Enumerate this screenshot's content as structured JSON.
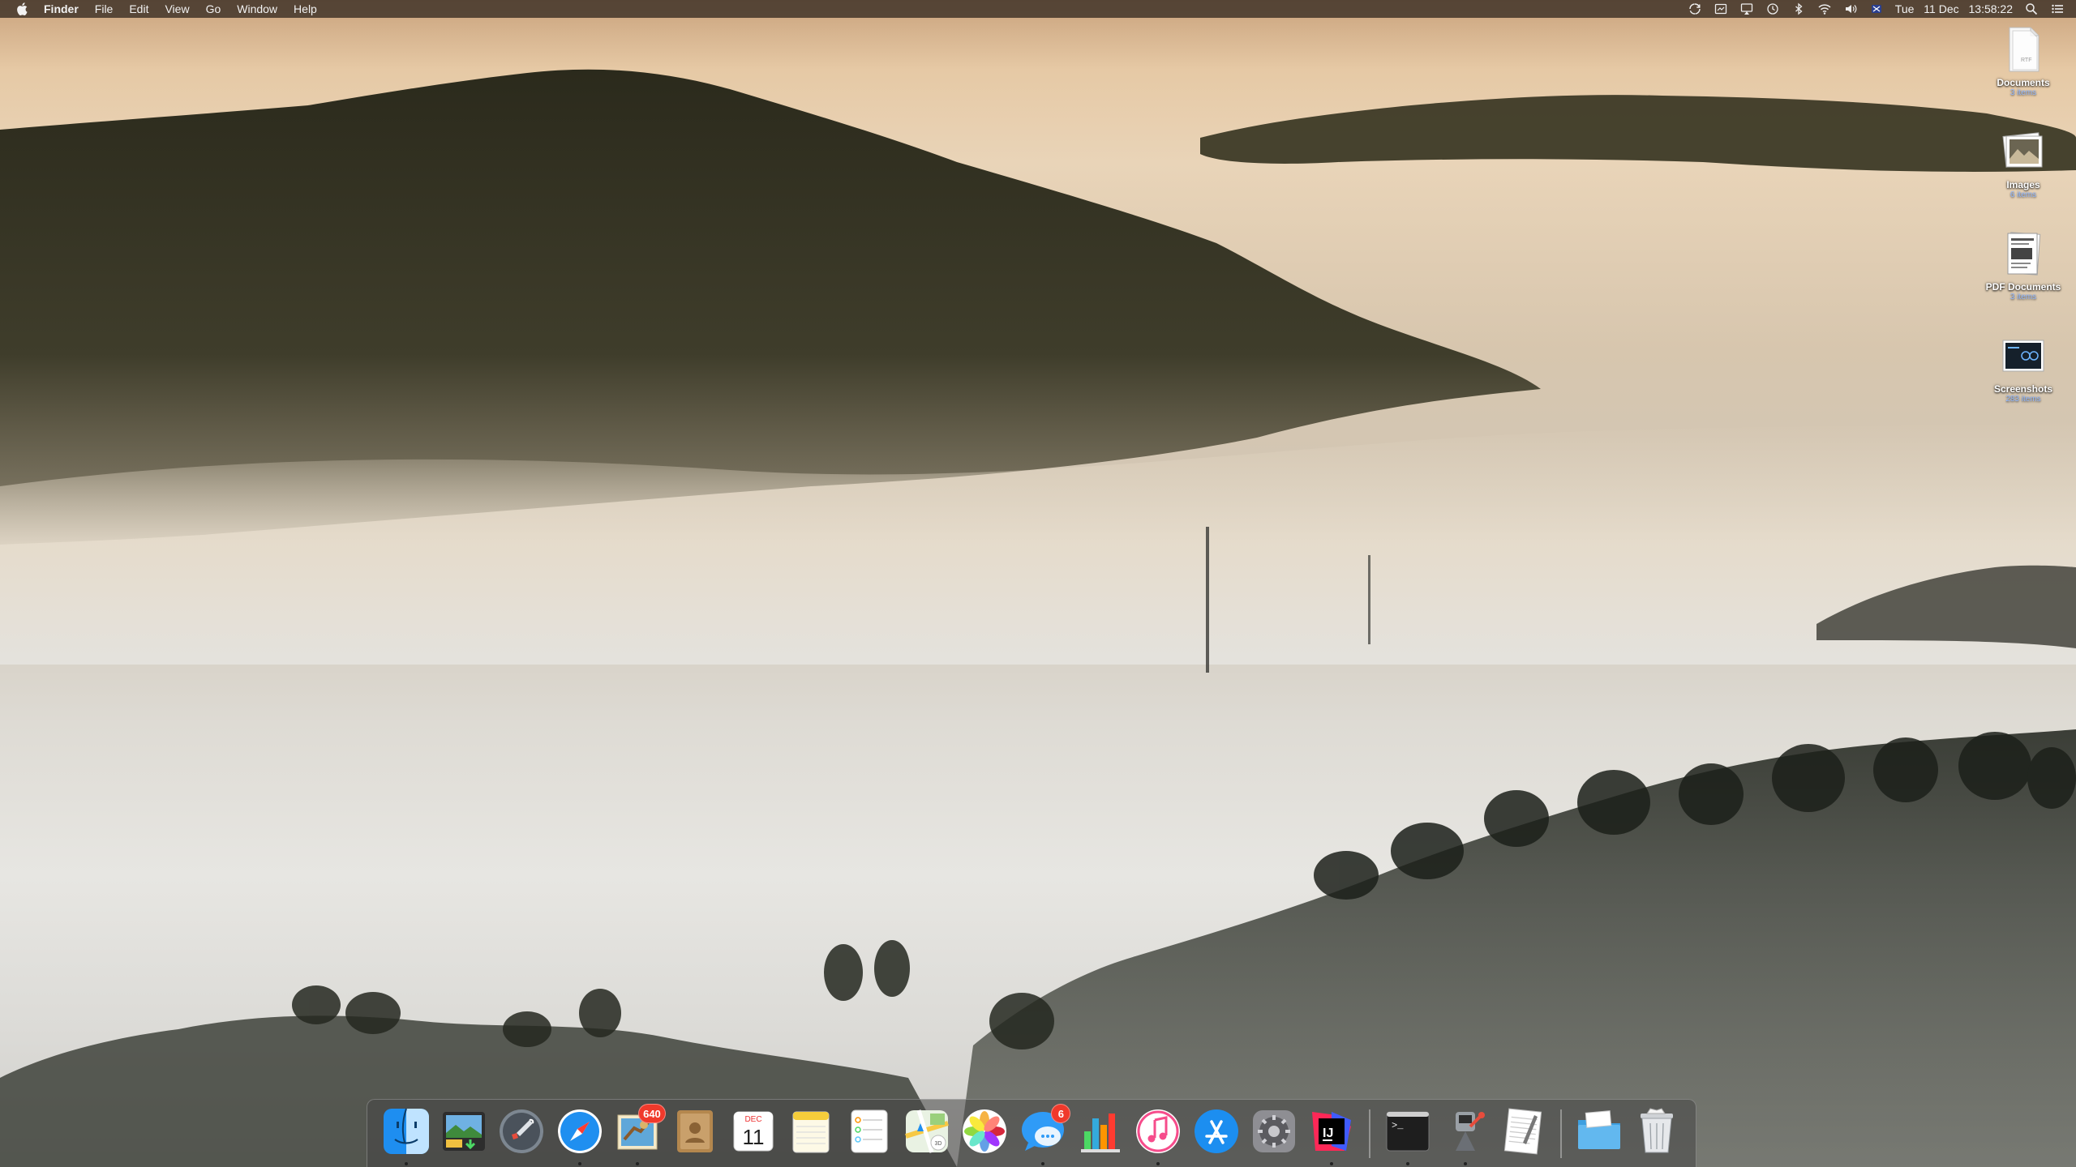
{
  "menubar": {
    "app_name": "Finder",
    "menus": [
      "File",
      "Edit",
      "View",
      "Go",
      "Window",
      "Help"
    ],
    "status_icons": [
      "sync-icon",
      "screen-recording-icon",
      "airplay-icon",
      "time-machine-icon",
      "bluetooth-icon",
      "wifi-icon",
      "volume-icon",
      "input-source-icon"
    ],
    "clock": {
      "day": "Tue",
      "date": "11 Dec",
      "time": "13:58:22"
    }
  },
  "desktop_icons": [
    {
      "name": "Documents",
      "sub": "3 items",
      "icon": "folder-stack-icon"
    },
    {
      "name": "Images",
      "sub": "6 items",
      "icon": "image-stack-icon"
    },
    {
      "name": "PDF Documents",
      "sub": "3 items",
      "icon": "pdf-stack-icon"
    },
    {
      "name": "Screenshots",
      "sub": "283 items",
      "icon": "screenshot-stack-icon"
    }
  ],
  "dock": {
    "apps": [
      {
        "name": "Finder",
        "icon": "finder-icon",
        "running": true
      },
      {
        "name": "Image Capture",
        "icon": "image-capture-icon",
        "running": false
      },
      {
        "name": "Launchpad",
        "icon": "launchpad-icon",
        "running": false
      },
      {
        "name": "Safari",
        "icon": "safari-icon",
        "running": true
      },
      {
        "name": "Mail",
        "icon": "mail-icon",
        "running": true,
        "badge": "640"
      },
      {
        "name": "Contacts",
        "icon": "contacts-icon",
        "running": false
      },
      {
        "name": "Calendar",
        "icon": "calendar-icon",
        "running": false,
        "month": "DEC",
        "day": "11"
      },
      {
        "name": "Notes",
        "icon": "notes-icon",
        "running": false
      },
      {
        "name": "Reminders",
        "icon": "reminders-icon",
        "running": false
      },
      {
        "name": "Maps",
        "icon": "maps-icon",
        "running": false
      },
      {
        "name": "Photos",
        "icon": "photos-icon",
        "running": false
      },
      {
        "name": "Messages",
        "icon": "messages-icon",
        "running": true,
        "badge": "6"
      },
      {
        "name": "Numbers",
        "icon": "numbers-icon",
        "running": false
      },
      {
        "name": "iTunes",
        "icon": "itunes-icon",
        "running": true
      },
      {
        "name": "App Store",
        "icon": "app-store-icon",
        "running": false
      },
      {
        "name": "System Preferences",
        "icon": "system-preferences-icon",
        "running": false
      },
      {
        "name": "IntelliJ IDEA",
        "icon": "intellij-icon",
        "running": true,
        "label": "IJ"
      }
    ],
    "utilities": [
      {
        "name": "Terminal",
        "icon": "terminal-icon",
        "running": true,
        "prompt": ">_"
      },
      {
        "name": "Automator",
        "icon": "automator-icon",
        "running": true
      },
      {
        "name": "TextEdit",
        "icon": "textedit-icon",
        "running": false
      }
    ],
    "trash_area": [
      {
        "name": "Downloads",
        "icon": "downloads-folder-icon"
      },
      {
        "name": "Trash",
        "icon": "trash-icon"
      }
    ]
  }
}
